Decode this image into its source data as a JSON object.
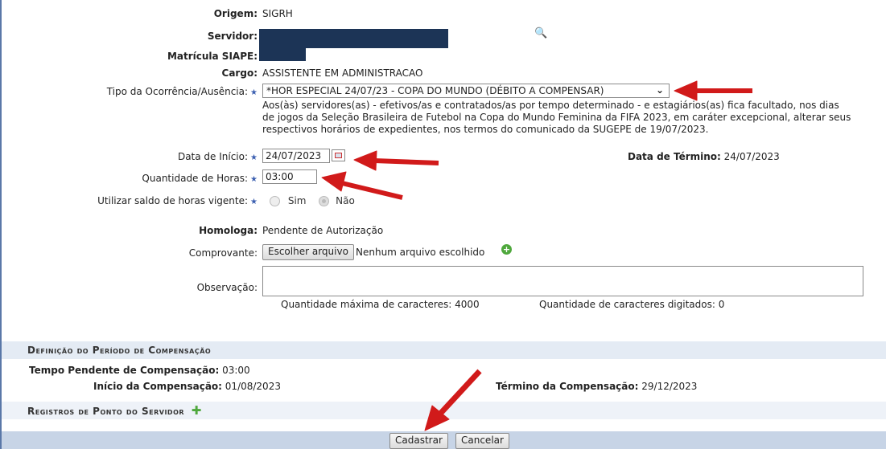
{
  "form": {
    "origem": {
      "label": "Origem:",
      "value": "SIGRH"
    },
    "servidor": {
      "label": "Servidor:"
    },
    "matricula": {
      "label": "Matrícula SIAPE:"
    },
    "cargo": {
      "label": "Cargo:",
      "value": "ASSISTENTE EM ADMINISTRACAO"
    },
    "tipo": {
      "label": "Tipo da Ocorrência/Ausência:",
      "selected": "*HOR ESPECIAL 24/07/23 - COPA DO MUNDO (DÉBITO A COMPENSAR)",
      "description_lines": [
        "Aos(às) servidores(as) - efetivos/as e contratados/as por tempo determinado - e estagiários(as) fica facultado, nos dias",
        "de jogos da Seleção Brasileira de Futebol na Copa do Mundo Feminina da FIFA 2023, em caráter excepcional, alterar seus",
        "respectivos horários de expedientes, nos termos do comunicado da SUGEPE de 19/07/2023."
      ]
    },
    "data_inicio": {
      "label": "Data de Início:",
      "value": "24/07/2023"
    },
    "data_termino": {
      "label": "Data de Término:",
      "value": "24/07/2023"
    },
    "quantidade_horas": {
      "label": "Quantidade de Horas:",
      "value": "03:00"
    },
    "saldo": {
      "label": "Utilizar saldo de horas vigente:",
      "opt_sim": "Sim",
      "opt_nao": "Não"
    },
    "homologa": {
      "label": "Homologa:",
      "value": "Pendente de Autorização"
    },
    "comprovante": {
      "label": "Comprovante:",
      "button": "Escolher arquivo",
      "status": "Nenhum arquivo escolhido"
    },
    "observacao": {
      "label": "Observação:",
      "max_chars": "Quantidade máxima de caracteres: 4000",
      "typed_chars": "Quantidade de caracteres digitados: 0"
    }
  },
  "compensacao": {
    "title": "Definição do Período de Compensação",
    "pendente_label": "Tempo Pendente de Compensação:",
    "pendente_value": "03:00",
    "inicio_label": "Início da Compensação:",
    "inicio_value": "01/08/2023",
    "termino_label": "Término da Compensação:",
    "termino_value": "29/12/2023"
  },
  "registros": {
    "title": "Registros de Ponto do Servidor"
  },
  "actions": {
    "submit": "Cadastrar",
    "cancel": "Cancelar"
  },
  "colors": {
    "accent": "#3b5fb0",
    "section_bg": "#e4ebf4",
    "annotation_arrow": "#d11a1a"
  }
}
